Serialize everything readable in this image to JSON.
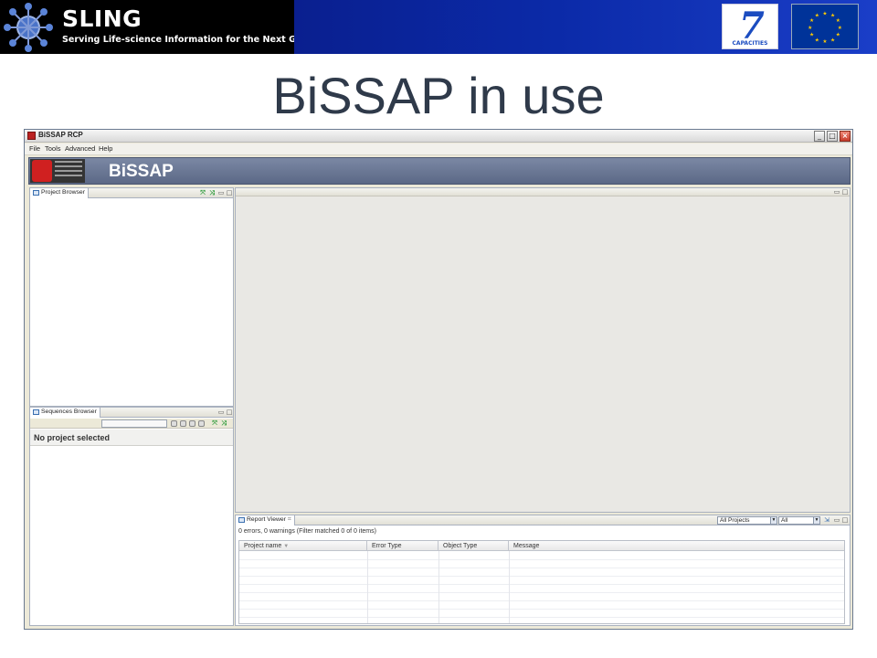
{
  "banner": {
    "title": "SLING",
    "subtitle": "Serving Life-science Information for the Next Generation",
    "fp7_label": "CAPACITIES",
    "fp7_number": "7",
    "logos": [
      "sling-logo",
      "fp7-logo",
      "eu-flag"
    ]
  },
  "slide": {
    "title": "BiSSAP in use"
  },
  "window": {
    "title": "BiSSAP RCP",
    "controls": [
      "minimize",
      "maximize",
      "close"
    ],
    "menu": [
      "File",
      "Tools",
      "Advanced",
      "Help"
    ],
    "app_name": "BiSSAP"
  },
  "panels": {
    "project_browser": {
      "title": "Project Browser"
    },
    "sequences_browser": {
      "title": "Sequences Browser",
      "empty_text": "No project selected"
    },
    "report_viewer": {
      "title": "Report Viewer",
      "status": "0 errors, 0 warnings (Filter matched 0 of 0 items)",
      "filter_scope": "All Projects",
      "filter_type": "All",
      "columns": [
        "Project name",
        "Error Type",
        "Object Type",
        "Message"
      ]
    }
  },
  "colors": {
    "banner_black": "#000000",
    "banner_blue": "#0b2aa8",
    "app_header": "#6b7895",
    "title_text": "#2f3a4a"
  }
}
